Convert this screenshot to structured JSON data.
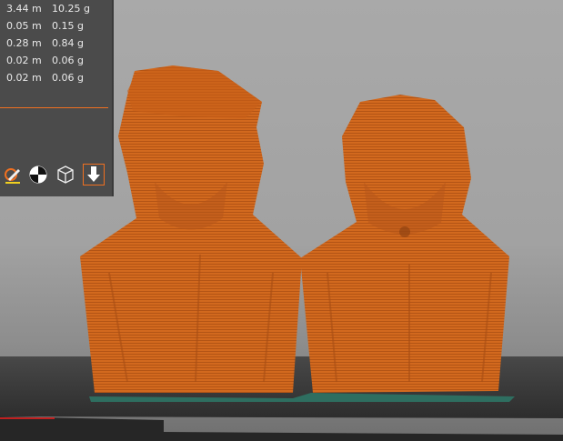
{
  "stats": [
    {
      "length": "3.44 m",
      "weight": "10.25 g"
    },
    {
      "length": "0.05 m",
      "weight": "0.15 g"
    },
    {
      "length": "0.28 m",
      "weight": "0.84 g"
    },
    {
      "length": "0.02 m",
      "weight": "0.06 g"
    },
    {
      "length": "0.02 m",
      "weight": "0.06 g"
    }
  ],
  "toolbar": {
    "icons": [
      "layer-edit-icon",
      "center-of-mass-icon",
      "wireframe-cube-icon",
      "export-download-icon"
    ]
  },
  "colors": {
    "panel_bg": "#4b4b4b",
    "accent": "#f07020",
    "model": "#d2691e",
    "bed": "#3a3a3a"
  }
}
